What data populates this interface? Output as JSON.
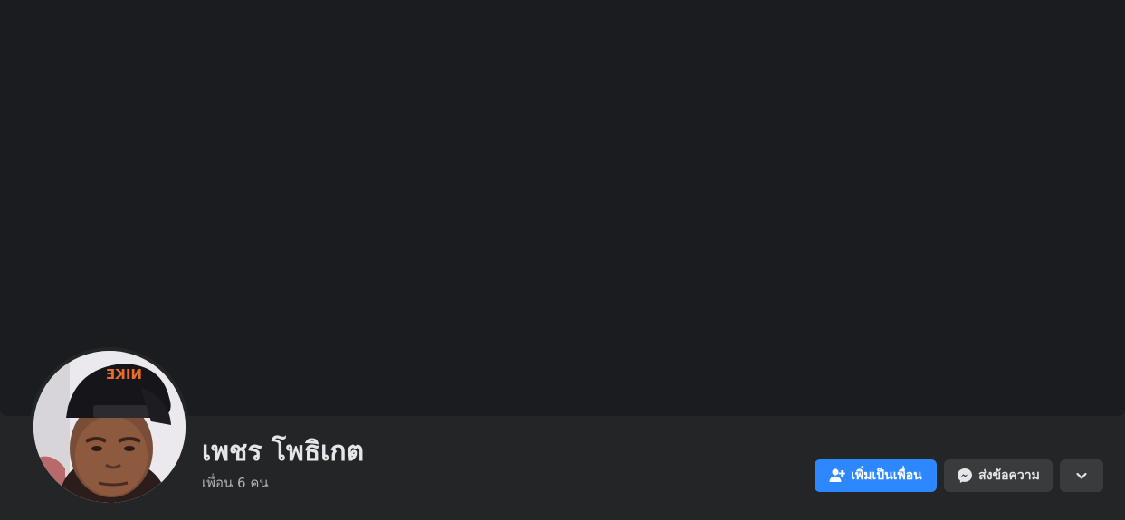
{
  "profile": {
    "name": "เพชร โพธิเกต",
    "friends_text": "เพื่อน 6 คน",
    "cap_text": "NIKE"
  },
  "actions": {
    "add_friend_label": "เพิ่มเป็นเพื่อน",
    "message_label": "ส่งข้อความ",
    "add_friend_icon": "person-add-icon",
    "message_icon": "messenger-icon",
    "more_icon": "chevron-down-icon"
  },
  "colors": {
    "primary_button": "#2d88ff",
    "secondary_button": "#3a3b3c",
    "background": "#242526",
    "cover": "#1b1c1f",
    "text_primary": "#e4e6eb",
    "text_secondary": "#b0b3b8"
  }
}
